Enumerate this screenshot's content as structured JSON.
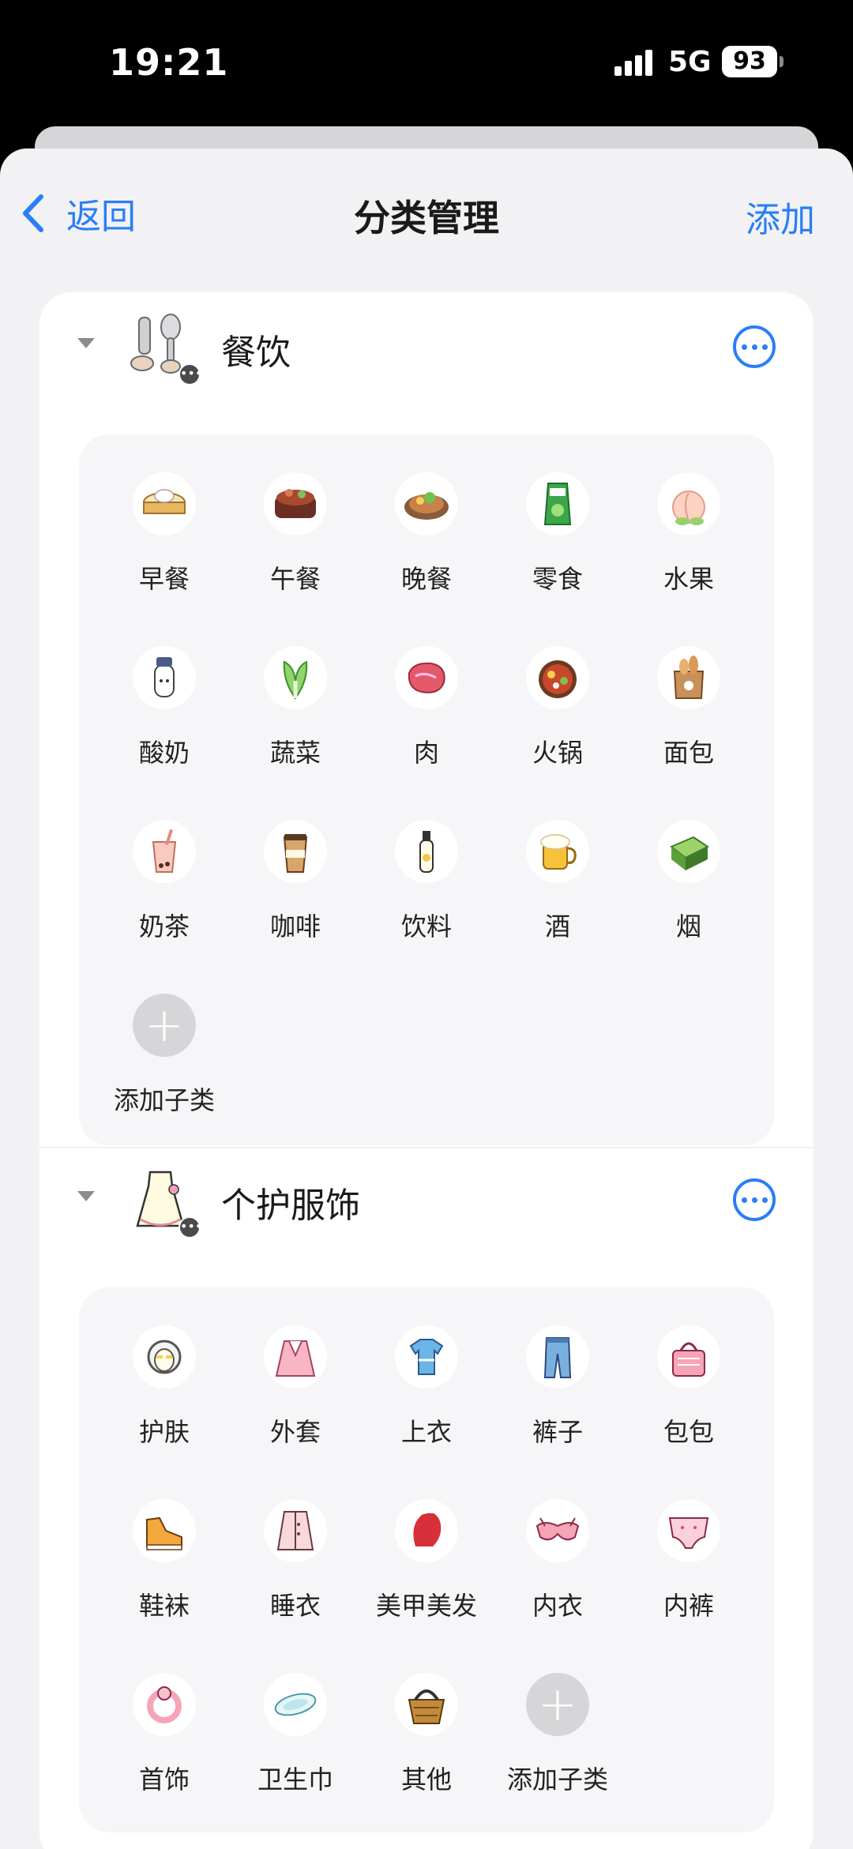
{
  "status_bar": {
    "time": "19:21",
    "network": "5G",
    "battery": "93"
  },
  "nav": {
    "back_label": "返回",
    "title": "分类管理",
    "add_label": "添加"
  },
  "groups": [
    {
      "name": "餐饮",
      "icon": "utensils-icon",
      "items": [
        {
          "label": "早餐",
          "icon": "dumpling-steamer-icon"
        },
        {
          "label": "午餐",
          "icon": "bento-icon"
        },
        {
          "label": "晚餐",
          "icon": "dinner-plate-icon"
        },
        {
          "label": "零食",
          "icon": "snack-bag-icon"
        },
        {
          "label": "水果",
          "icon": "peach-icon"
        },
        {
          "label": "酸奶",
          "icon": "yogurt-bottle-icon"
        },
        {
          "label": "蔬菜",
          "icon": "bok-choy-icon"
        },
        {
          "label": "肉",
          "icon": "steak-icon"
        },
        {
          "label": "火锅",
          "icon": "hotpot-icon"
        },
        {
          "label": "面包",
          "icon": "bread-bag-icon"
        },
        {
          "label": "奶茶",
          "icon": "bubble-tea-icon"
        },
        {
          "label": "咖啡",
          "icon": "coffee-cup-icon"
        },
        {
          "label": "饮料",
          "icon": "drink-bottle-icon"
        },
        {
          "label": "酒",
          "icon": "beer-mug-icon"
        },
        {
          "label": "烟",
          "icon": "cigarette-pack-icon"
        }
      ],
      "add_label": "添加子类"
    },
    {
      "name": "个护服饰",
      "icon": "dress-icon",
      "items": [
        {
          "label": "护肤",
          "icon": "face-mask-icon"
        },
        {
          "label": "外套",
          "icon": "jacket-icon"
        },
        {
          "label": "上衣",
          "icon": "tshirt-icon"
        },
        {
          "label": "裤子",
          "icon": "jeans-icon"
        },
        {
          "label": "包包",
          "icon": "handbag-icon"
        },
        {
          "label": "鞋袜",
          "icon": "sneaker-icon"
        },
        {
          "label": "睡衣",
          "icon": "pajamas-icon"
        },
        {
          "label": "美甲美发",
          "icon": "hair-salon-icon"
        },
        {
          "label": "内衣",
          "icon": "bra-icon"
        },
        {
          "label": "内裤",
          "icon": "briefs-icon"
        },
        {
          "label": "首饰",
          "icon": "bracelet-icon"
        },
        {
          "label": "卫生巾",
          "icon": "sanitary-pad-icon"
        },
        {
          "label": "其他",
          "icon": "basket-icon"
        }
      ],
      "add_label": "添加子类"
    }
  ],
  "colors": {
    "accent": "#2a7ef6",
    "background": "#f2f2f4"
  }
}
